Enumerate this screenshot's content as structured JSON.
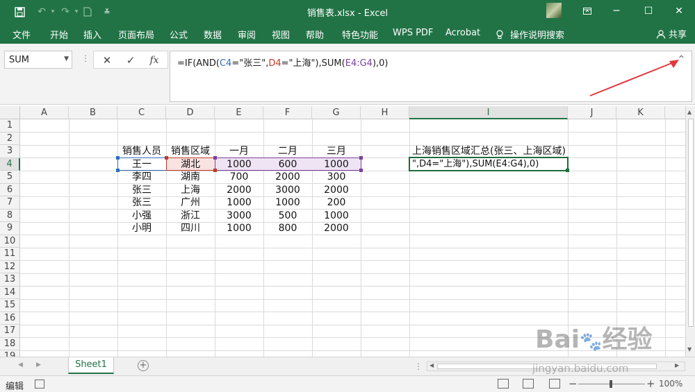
{
  "window": {
    "title": "销售表.xlsx  -  Excel",
    "accent": "#217346"
  },
  "quick_access": [
    "save-icon",
    "undo-icon",
    "redo-icon",
    "new-file-icon",
    "customize-icon"
  ],
  "ribbon_tabs": [
    "文件",
    "开始",
    "插入",
    "页面布局",
    "公式",
    "数据",
    "审阅",
    "视图",
    "帮助",
    "特色功能",
    "WPS PDF",
    "Acrobat",
    "操作说明搜索"
  ],
  "share_label": "共享",
  "namebox": "SUM",
  "formula": {
    "p1": "=IF(AND(",
    "c4": "C4",
    "p2": "=\"张三\",",
    "d4": "D4",
    "p3": "=\"上海\"),SUM(",
    "e4": "E4:G4",
    "p4": "),0)"
  },
  "columns": [
    "A",
    "B",
    "C",
    "D",
    "E",
    "F",
    "G",
    "H",
    "I",
    "J",
    "K"
  ],
  "rows": [
    "1",
    "2",
    "3",
    "4",
    "5",
    "6",
    "7",
    "8",
    "9",
    "10",
    "11",
    "12",
    "13",
    "14",
    "15",
    "16",
    "17",
    "18",
    "19"
  ],
  "table": {
    "headers": [
      "销售人员",
      "销售区域",
      "一月",
      "二月",
      "三月"
    ],
    "data": [
      [
        "王一",
        "湖北",
        "1000",
        "600",
        "1000"
      ],
      [
        "李四",
        "湖南",
        "700",
        "2000",
        "300"
      ],
      [
        "张三",
        "上海",
        "2000",
        "3000",
        "2000"
      ],
      [
        "张三",
        "广州",
        "1000",
        "1000",
        "200"
      ],
      [
        "小强",
        "浙江",
        "3000",
        "500",
        "1000"
      ],
      [
        "小明",
        "四川",
        "1000",
        "800",
        "2000"
      ]
    ]
  },
  "summary_label": "上海销售区域汇总(张三、上海区域)",
  "editing_cell_text": "\",D4=\"上海\"),SUM(E4:G4),0)",
  "sheet_tab": "Sheet1",
  "status": {
    "mode": "编辑",
    "zoom": "100%"
  },
  "watermark": {
    "url": "jingyan.baidu.com"
  }
}
